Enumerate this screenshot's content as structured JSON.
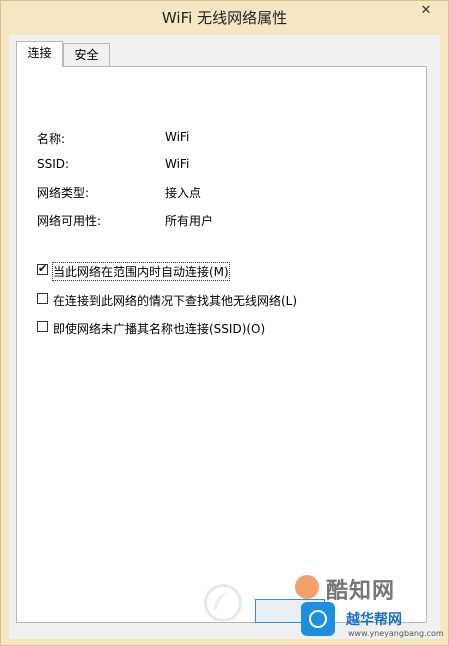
{
  "window": {
    "title": "WiFi 无线网络属性",
    "close_glyph": "✕"
  },
  "tabs": [
    {
      "label": "连接",
      "active": true
    },
    {
      "label": "安全",
      "active": false
    }
  ],
  "properties": [
    {
      "label": "名称:",
      "value": "WiFi"
    },
    {
      "label": "SSID:",
      "value": "WiFi"
    },
    {
      "label": "网络类型:",
      "value": "接入点"
    },
    {
      "label": "网络可用性:",
      "value": "所有用户"
    }
  ],
  "options": [
    {
      "label": "当此网络在范围内时自动连接(M)",
      "checked": true
    },
    {
      "label": "在连接到此网络的情况下查找其他无线网络(L)",
      "checked": false
    },
    {
      "label": "即使网络未广播其名称也连接(SSID)(O)",
      "checked": false
    }
  ],
  "watermark": {
    "brand_text": "酷知网",
    "site_text": "越华帮网",
    "site_url": "www.yneyangbang.com"
  },
  "colors": {
    "accent": "#2f8fd6",
    "frame": "#f4e7c2"
  }
}
